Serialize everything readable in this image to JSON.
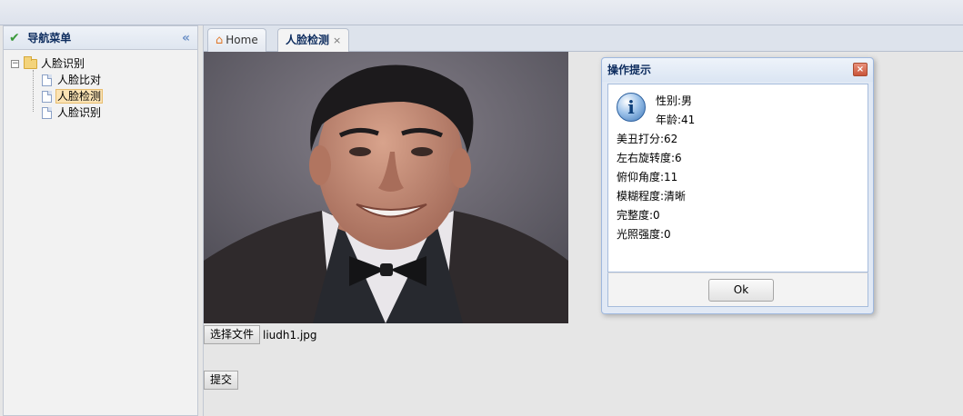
{
  "sidebar": {
    "title": "导航菜单",
    "collapse_icon": "double-chevron-left-icon",
    "tree": {
      "root": {
        "label": "人脸识别",
        "toggle": "⊟"
      },
      "children": [
        {
          "label": "人脸比对",
          "selected": false
        },
        {
          "label": "人脸检测",
          "selected": true
        },
        {
          "label": "人脸识别",
          "selected": false
        }
      ]
    }
  },
  "tabs": [
    {
      "label": "Home",
      "icon": "home-icon",
      "active": false
    },
    {
      "label": "人脸检测",
      "active": true,
      "close": "×"
    }
  ],
  "form": {
    "file_button": "选择文件",
    "file_name": "liudh1.jpg",
    "submit_button": "提交"
  },
  "dialog": {
    "title": "操作提示",
    "close": "×",
    "icon": "info-icon",
    "lines": [
      "性别:男",
      "年龄:41",
      "美丑打分:62",
      "左右旋转度:6",
      "俯仰角度:11",
      "模糊程度:清晰",
      "完整度:0",
      "光照强度:0"
    ],
    "ok_button": "Ok"
  },
  "colors": {
    "accent": "#0e2d5f",
    "selected_bg": "#fbe3b4",
    "close_red": "#c9553a"
  }
}
